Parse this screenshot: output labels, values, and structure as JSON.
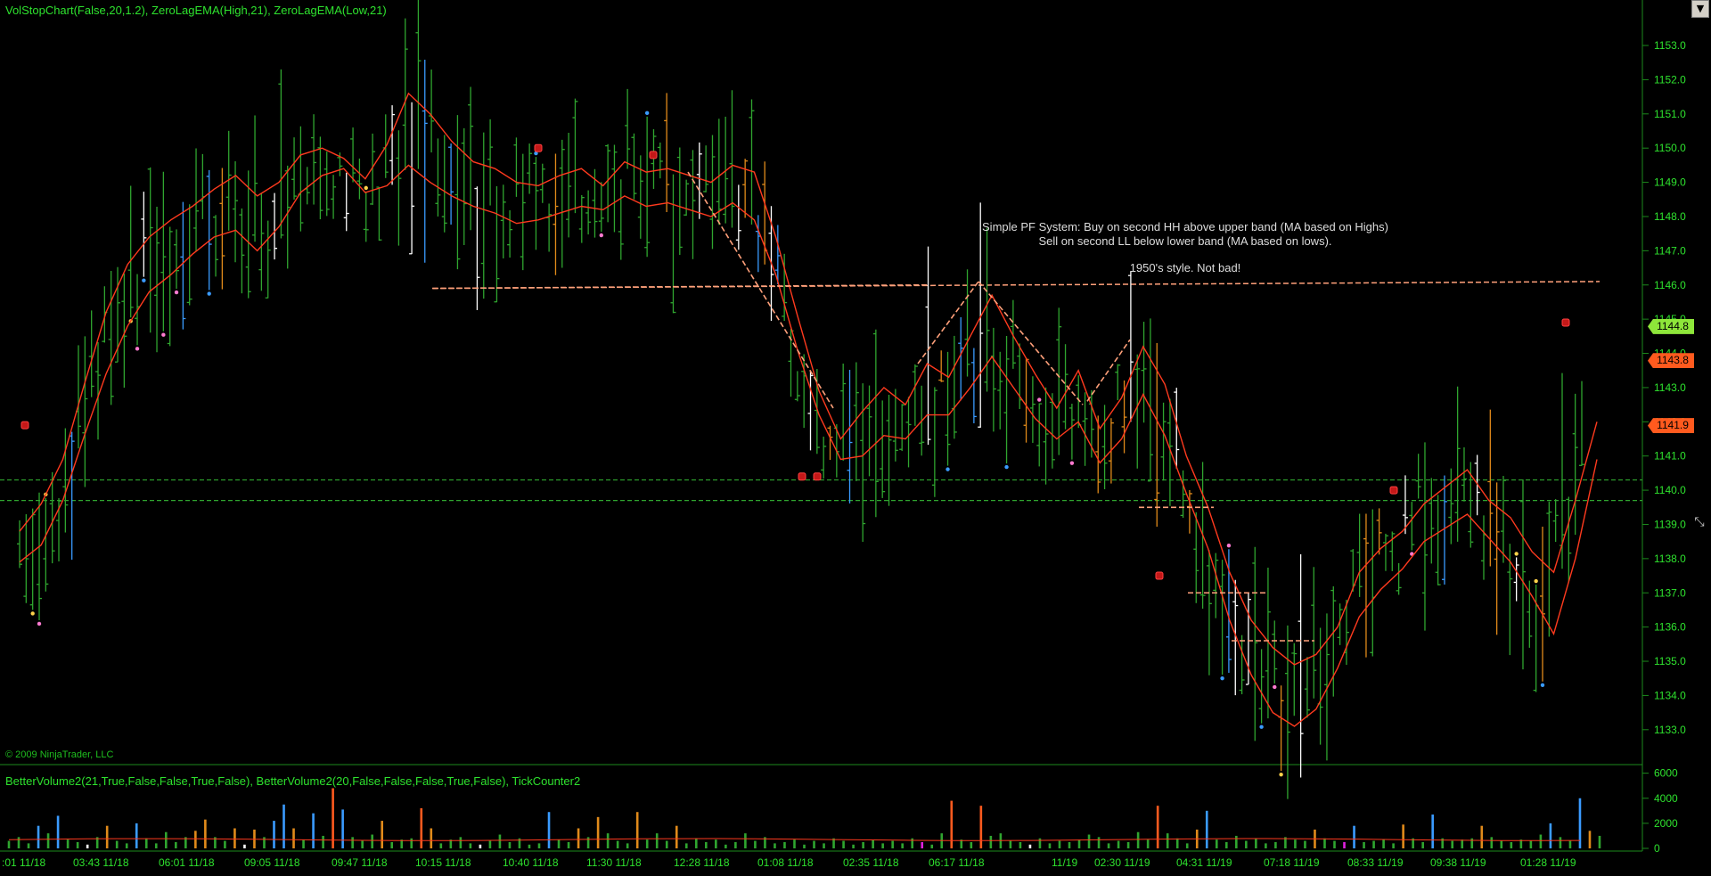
{
  "header": {
    "indicator_label": "VolStopChart(False,20,1.2),  ZeroLagEMA(High,21),  ZeroLagEMA(Low,21)"
  },
  "volume_panel": {
    "indicator_label": "BetterVolume2(21,True,False,False,True,False),   BetterVolume2(20,False,False,False,True,False),   TickCounter2"
  },
  "copyright": "© 2009 NinjaTrader, LLC",
  "annotation": {
    "line1": "Simple PF System: Buy on second HH above upper band (MA based on Highs)",
    "line2": "Sell on second LL below lower band (MA based on lows).",
    "line3": "1950's style. Not bad!"
  },
  "price_tags": [
    {
      "label": "1144.8",
      "value": 1144.8,
      "color": "#8ee63a"
    },
    {
      "label": "1143.8",
      "value": 1143.8,
      "color": "#ff5a1e"
    },
    {
      "label": "1141.9",
      "value": 1141.9,
      "color": "#ff5a1e"
    }
  ],
  "chart_data": [
    {
      "type": "bar",
      "subtype": "ohlc-price",
      "title": "VolStopChart(False,20,1.2),  ZeroLagEMA(High,21),  ZeroLagEMA(Low,21)",
      "y_ticks": [
        "1133.0",
        "1134.0",
        "1135.0",
        "1136.0",
        "1137.0",
        "1138.0",
        "1139.0",
        "1140.0",
        "1141.0",
        "1142.0",
        "1143.0",
        "1144.0",
        "1145.0",
        "1146.0",
        "1147.0",
        "1148.0",
        "1149.0",
        "1150.0",
        "1151.0",
        "1152.0",
        "1153.0"
      ],
      "ylim": [
        1132.5,
        1153.6
      ],
      "x_tick_labels": [
        ":01 11/18",
        "03:43 11/18",
        "06:01 11/18",
        "09:05 11/18",
        "09:47 11/18",
        "10:15 11/18",
        "10:40 11/18",
        "11:30 11/18",
        "12:28 11/18",
        "01:08 11/18",
        "02:35 11/18",
        "06:17 11/18",
        "11/19",
        "02:30 11/19",
        "04:31 11/19",
        "07:18 11/19",
        "08:33 11/19",
        "09:38 11/19",
        "01:28 11/19"
      ],
      "reference_lines": {
        "green_dashed": [
          1140.3,
          1139.7
        ],
        "salmon_dashed_resistance": [
          1145.9,
          1146.1
        ]
      },
      "colors": {
        "up_bar": "#2fa52f",
        "down_bar": "#2fa52f",
        "reversal_bar": "#ffffff",
        "large_bar": "#3a9bff",
        "orange_bar": "#e08a1a",
        "ema_line": "#ff3a1e",
        "green_level": "#2fa52f",
        "pf_line": "#ffa07a"
      },
      "series": [
        {
          "name": "ZeroLagEMA(High,21)",
          "values": [
            1138.8,
            1139.6,
            1140.9,
            1143.1,
            1145.2,
            1146.6,
            1147.4,
            1147.9,
            1148.3,
            1148.8,
            1149.2,
            1148.6,
            1149.0,
            1149.8,
            1150.0,
            1149.7,
            1149.1,
            1150.1,
            1151.6,
            1151.0,
            1150.2,
            1149.6,
            1149.4,
            1149.0,
            1148.9,
            1149.2,
            1149.4,
            1148.9,
            1149.6,
            1149.3,
            1149.4,
            1149.2,
            1149.0,
            1149.5,
            1149.3,
            1147.4,
            1145.1,
            1142.9,
            1141.5,
            1142.3,
            1143.0,
            1142.5,
            1143.7,
            1143.3,
            1144.5,
            1145.7,
            1144.5,
            1143.4,
            1142.4,
            1143.5,
            1141.8,
            1142.7,
            1144.2,
            1143.1,
            1141.0,
            1139.5,
            1137.6,
            1136.2,
            1135.4,
            1134.9,
            1135.2,
            1136.0,
            1137.6,
            1138.3,
            1138.8,
            1139.6,
            1140.1,
            1140.6,
            1139.7,
            1139.2,
            1138.2,
            1137.6,
            1139.7,
            1142.0
          ]
        },
        {
          "name": "ZeroLagEMA(Low,21)",
          "values": [
            1137.9,
            1138.4,
            1139.7,
            1141.6,
            1143.4,
            1144.8,
            1145.8,
            1146.3,
            1146.9,
            1147.4,
            1147.6,
            1147.0,
            1147.7,
            1148.7,
            1149.2,
            1149.4,
            1148.7,
            1148.9,
            1149.5,
            1149.0,
            1148.6,
            1148.3,
            1148.1,
            1147.8,
            1147.9,
            1148.1,
            1148.3,
            1148.2,
            1148.6,
            1148.3,
            1148.4,
            1148.2,
            1148.0,
            1148.4,
            1147.9,
            1146.3,
            1144.1,
            1142.2,
            1140.9,
            1141.0,
            1141.6,
            1141.5,
            1142.2,
            1142.2,
            1143.0,
            1143.9,
            1143.0,
            1142.1,
            1141.5,
            1142.0,
            1140.8,
            1141.5,
            1142.8,
            1141.6,
            1139.9,
            1138.3,
            1136.2,
            1134.6,
            1133.5,
            1133.1,
            1133.6,
            1134.8,
            1136.3,
            1137.1,
            1137.7,
            1138.5,
            1138.9,
            1139.3,
            1138.6,
            1137.9,
            1136.9,
            1135.8,
            1138.0,
            1140.9
          ]
        }
      ]
    },
    {
      "type": "bar",
      "subtype": "volume",
      "title": "BetterVolume2(21,True,False,False,True,False),   BetterVolume2(20,False,False,False,True,False),   TickCounter2",
      "y_ticks": [
        "0",
        "2000",
        "4000",
        "6000"
      ],
      "ylim": [
        0,
        6400
      ],
      "colors": {
        "normal": "#2fa52f",
        "climax": "#ff5a1e",
        "high": "#3a9bff",
        "medium": "#e08a1a",
        "low": "#ffffff",
        "churn": "#e020e0",
        "avg_line": "#ff3a1e"
      },
      "values": [
        600,
        900,
        400,
        1800,
        1200,
        2600,
        700,
        500,
        300,
        900,
        1800,
        600,
        400,
        2000,
        800,
        400,
        1300,
        500,
        900,
        1400,
        2300,
        900,
        600,
        1600,
        300,
        1500,
        900,
        2200,
        3500,
        1600,
        700,
        2800,
        1000,
        4800,
        3100,
        900,
        600,
        1100,
        2200,
        500,
        700,
        800,
        3200,
        1600,
        400,
        700,
        900,
        400,
        300,
        600,
        1100,
        500,
        800,
        300,
        400,
        2900,
        700,
        500,
        1600,
        900,
        2500,
        1200,
        600,
        400,
        2900,
        700,
        1200,
        600,
        1800,
        400,
        800,
        500,
        700,
        300,
        500,
        1200,
        600,
        900,
        400,
        500,
        700,
        300,
        600,
        400,
        800,
        600,
        300,
        500,
        700,
        400,
        600,
        400,
        800,
        500,
        300,
        1200,
        3800,
        700,
        500,
        3400,
        1000,
        1200,
        600,
        500,
        300,
        800,
        400,
        600,
        500,
        700,
        1100,
        900,
        400,
        600,
        500,
        1300,
        700,
        3400,
        1200,
        800,
        400,
        1500,
        3000,
        700,
        500,
        1000,
        600,
        800,
        400,
        500,
        900,
        700,
        600,
        1500,
        800,
        600,
        500,
        1800,
        500,
        600,
        700,
        400,
        1900,
        800,
        500,
        2700,
        800,
        600,
        700,
        800,
        1800,
        900,
        600,
        500,
        700,
        600,
        1100,
        2000,
        900,
        600,
        4000,
        1400,
        1000
      ]
    }
  ]
}
